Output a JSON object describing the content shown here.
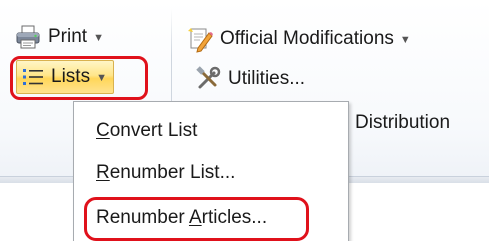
{
  "ribbon": {
    "print_label": "Print",
    "lists_label": "Lists",
    "official_modifications_label": "Official Modifications",
    "utilities_label": "Utilities...",
    "distribution_label": "Distribution"
  },
  "menu": {
    "items": [
      {
        "pre": "",
        "mnemonic": "C",
        "post": "onvert List"
      },
      {
        "pre": "",
        "mnemonic": "R",
        "post": "enumber List..."
      },
      {
        "pre": "Renumber ",
        "mnemonic": "A",
        "post": "rticles..."
      }
    ]
  },
  "icons": {
    "print": "printer-icon",
    "lists": "bullet-list-icon",
    "official_modifications": "document-edit-icon",
    "utilities": "tools-icon",
    "dropdown": "caret-down-icon"
  },
  "colors": {
    "highlight_outline": "#e0111b",
    "active_button": "#ffe68a"
  }
}
